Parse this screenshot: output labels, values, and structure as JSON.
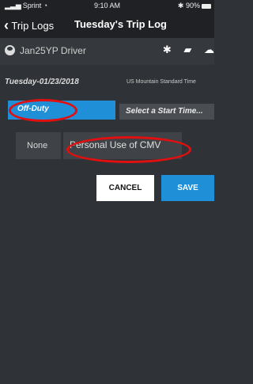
{
  "status_bar": {
    "carrier": "Sprint",
    "time": "9:10 AM",
    "battery": "90%"
  },
  "nav": {
    "back_label": "Trip Logs",
    "title": "Tuesday's Trip Log"
  },
  "driver": {
    "name": "Jan25YP Driver",
    "icons": [
      "bluetooth-icon",
      "truck-engine-icon",
      "cloud-icon"
    ]
  },
  "log": {
    "date": "Tuesday-01/23/2018",
    "timezone": "US Mountain Standard Time"
  },
  "duty": {
    "status": "Off-Duty",
    "start_time_placeholder": "Select a Start Time..."
  },
  "special_conditions": {
    "options": [
      "None",
      "Personal Use of CMV"
    ],
    "selected": "Personal Use of CMV"
  },
  "actions": {
    "cancel": "CANCEL",
    "save": "SAVE"
  },
  "colors": {
    "background": "#2f3236",
    "accent": "#1f8fd8",
    "annotation": "#e10f0f"
  }
}
